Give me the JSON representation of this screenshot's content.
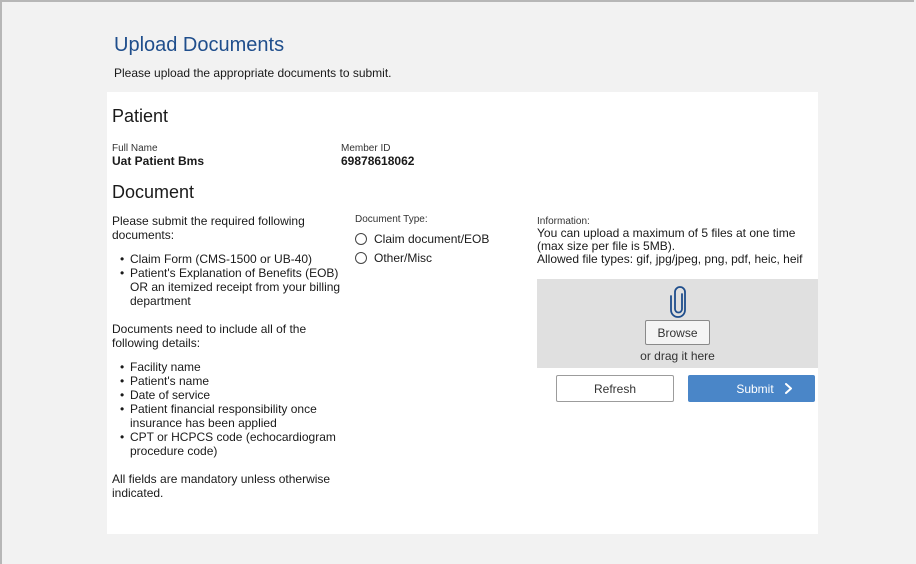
{
  "header": {
    "title": "Upload Documents",
    "subtitle": "Please upload the appropriate documents to submit."
  },
  "patient": {
    "section_title": "Patient",
    "full_name_label": "Full Name",
    "full_name": "Uat Patient Bms",
    "member_id_label": "Member ID",
    "member_id": "69878618062"
  },
  "document": {
    "section_title": "Document",
    "instructions_intro": "Please submit the required following documents:",
    "required_docs": [
      "Claim Form (CMS-1500 or UB-40)",
      "Patient's Explanation of Benefits (EOB) OR an itemized receipt from your billing department"
    ],
    "details_intro": "Documents need to include all of the following details:",
    "required_details": [
      "Facility name",
      "Patient's name",
      "Date of service",
      "Patient financial responsibility once insurance has been applied",
      "CPT or HCPCS code (echocardiogram procedure code)"
    ],
    "mandatory_note": "All fields are mandatory unless otherwise indicated.",
    "doc_type_label": "Document Type:",
    "doc_type_options": [
      "Claim document/EOB",
      "Other/Misc"
    ]
  },
  "upload": {
    "info_label": "Information:",
    "info_line1": "You can upload a maximum of 5 files at one time",
    "info_line2": "(max size per file is 5MB).",
    "info_line3": "Allowed file types: gif, jpg/jpeg, png, pdf, heic, heif",
    "browse_label": "Browse",
    "drag_text": "or drag it here",
    "refresh_label": "Refresh",
    "submit_label": "Submit"
  },
  "colors": {
    "title_blue": "#1f4e8c",
    "submit_blue": "#4a86c8",
    "dropzone_gray": "#e0e0e0",
    "page_bg": "#f2f2f2"
  },
  "icons": [
    "paperclip-icon",
    "chevron-right-icon",
    "radio-icon"
  ]
}
